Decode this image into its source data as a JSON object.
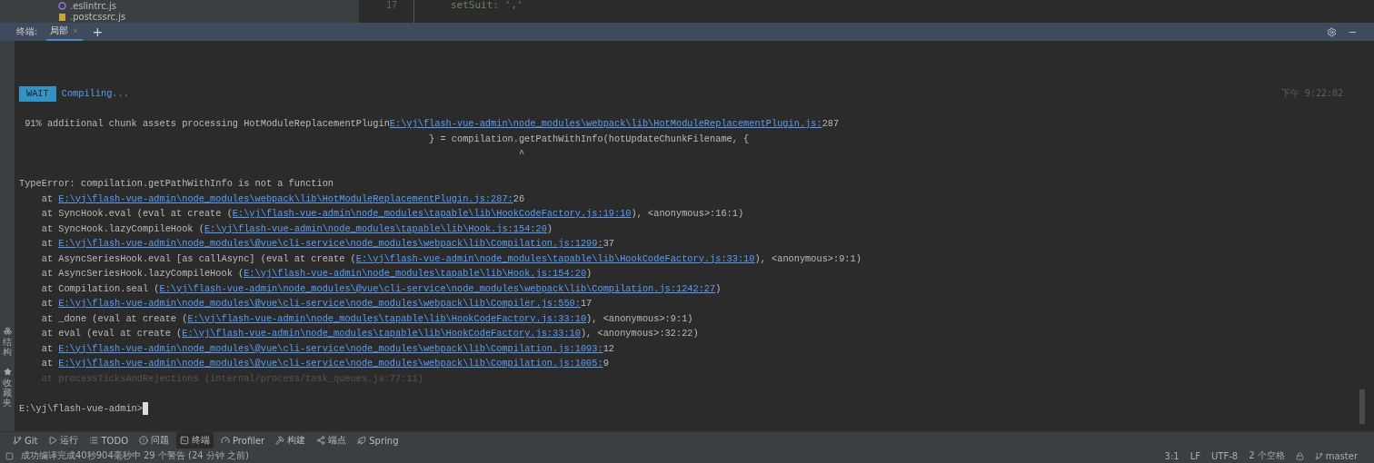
{
  "editor": {
    "files": [
      {
        "name": ".eslintrc.js",
        "kind": "eslint"
      },
      {
        "name": ".postcssrc.js",
        "kind": "js"
      }
    ],
    "line_number": "17",
    "code": "setSuit: ','"
  },
  "terminal": {
    "label": "终端:",
    "tabs": [
      {
        "label": "局部",
        "selected": true
      }
    ],
    "add": "+",
    "wait": {
      "badge": "WAIT",
      "text": "Compiling...",
      "time": "下午 9:22:02"
    },
    "lines": [
      {
        "blank_before": true,
        "segments": [
          {
            "kind": "text",
            "text": " 91% additional chunk assets processing HotModuleReplacementPlugin"
          },
          {
            "kind": "link",
            "text": "E:\\yj\\flash-vue-admin\\node_modules\\webpack\\lib\\HotModuleReplacementPlugin.js:"
          },
          {
            "kind": "text",
            "text": "287"
          }
        ]
      },
      {
        "segments": [
          {
            "kind": "text",
            "text": "                                                                         } = compilation.getPathWithInfo(hotUpdateChunkFilename, {"
          }
        ]
      },
      {
        "segments": [
          {
            "kind": "text",
            "text": "                                                                                         ^"
          }
        ]
      },
      {
        "blank_before": true,
        "segments": [
          {
            "kind": "text",
            "text": "TypeError: compilation.getPathWithInfo is not a function"
          }
        ]
      },
      {
        "segments": [
          {
            "kind": "text",
            "text": "    at "
          },
          {
            "kind": "link",
            "text": "E:\\yj\\flash-vue-admin\\node_modules\\webpack\\lib\\HotModuleReplacementPlugin.js:287:"
          },
          {
            "kind": "text",
            "text": "26"
          }
        ]
      },
      {
        "segments": [
          {
            "kind": "text",
            "text": "    at SyncHook.eval (eval at create ("
          },
          {
            "kind": "link",
            "text": "E:\\yj\\flash-vue-admin\\node_modules\\tapable\\lib\\HookCodeFactory.js:19:10"
          },
          {
            "kind": "text",
            "text": "), <anonymous>:16:1)"
          }
        ]
      },
      {
        "segments": [
          {
            "kind": "text",
            "text": "    at SyncHook.lazyCompileHook ("
          },
          {
            "kind": "link",
            "text": "E:\\yj\\flash-vue-admin\\node_modules\\tapable\\lib\\Hook.js:154:20"
          },
          {
            "kind": "text",
            "text": ")"
          }
        ]
      },
      {
        "segments": [
          {
            "kind": "text",
            "text": "    at "
          },
          {
            "kind": "link",
            "text": "E:\\yj\\flash-vue-admin\\node_modules\\@vue\\cli-service\\node_modules\\webpack\\lib\\Compilation.js:1299:"
          },
          {
            "kind": "text",
            "text": "37"
          }
        ]
      },
      {
        "segments": [
          {
            "kind": "text",
            "text": "    at AsyncSeriesHook.eval [as callAsync] (eval at create ("
          },
          {
            "kind": "link",
            "text": "E:\\yj\\flash-vue-admin\\node_modules\\tapable\\lib\\HookCodeFactory.js:33:10"
          },
          {
            "kind": "text",
            "text": "), <anonymous>:9:1)"
          }
        ]
      },
      {
        "segments": [
          {
            "kind": "text",
            "text": "    at AsyncSeriesHook.lazyCompileHook ("
          },
          {
            "kind": "link",
            "text": "E:\\yj\\flash-vue-admin\\node_modules\\tapable\\lib\\Hook.js:154:20"
          },
          {
            "kind": "text",
            "text": ")"
          }
        ]
      },
      {
        "segments": [
          {
            "kind": "text",
            "text": "    at Compilation.seal ("
          },
          {
            "kind": "link",
            "text": "E:\\yj\\flash-vue-admin\\node_modules\\@vue\\cli-service\\node_modules\\webpack\\lib\\Compilation.js:1242:27"
          },
          {
            "kind": "text",
            "text": ")"
          }
        ]
      },
      {
        "segments": [
          {
            "kind": "text",
            "text": "    at "
          },
          {
            "kind": "link",
            "text": "E:\\yj\\flash-vue-admin\\node_modules\\@vue\\cli-service\\node_modules\\webpack\\lib\\Compiler.js:550:"
          },
          {
            "kind": "text",
            "text": "17"
          }
        ]
      },
      {
        "segments": [
          {
            "kind": "text",
            "text": "    at _done (eval at create ("
          },
          {
            "kind": "link",
            "text": "E:\\yj\\flash-vue-admin\\node_modules\\tapable\\lib\\HookCodeFactory.js:33:10"
          },
          {
            "kind": "text",
            "text": "), <anonymous>:9:1)"
          }
        ]
      },
      {
        "segments": [
          {
            "kind": "text",
            "text": "    at eval (eval at create ("
          },
          {
            "kind": "link",
            "text": "E:\\yj\\flash-vue-admin\\node_modules\\tapable\\lib\\HookCodeFactory.js:33:10"
          },
          {
            "kind": "text",
            "text": "), <anonymous>:32:22)"
          }
        ]
      },
      {
        "segments": [
          {
            "kind": "text",
            "text": "    at "
          },
          {
            "kind": "link",
            "text": "E:\\yj\\flash-vue-admin\\node_modules\\@vue\\cli-service\\node_modules\\webpack\\lib\\Compilation.js:1093:"
          },
          {
            "kind": "text",
            "text": "12"
          }
        ]
      },
      {
        "segments": [
          {
            "kind": "text",
            "text": "    at "
          },
          {
            "kind": "link",
            "text": "E:\\yj\\flash-vue-admin\\node_modules\\@vue\\cli-service\\node_modules\\webpack\\lib\\Compilation.js:1005:"
          },
          {
            "kind": "text",
            "text": "9"
          }
        ]
      },
      {
        "segments": [
          {
            "kind": "dim",
            "text": "    at processTicksAndRejections (internal/process/task_queues.js:77:11)"
          }
        ]
      },
      {
        "blank_before": true,
        "segments": [
          {
            "kind": "text",
            "text": "E:\\yj\\flash-vue-admin>"
          }
        ],
        "cursor": true
      }
    ]
  },
  "side_tabs": [
    {
      "label": "结构",
      "kind": "structure"
    },
    {
      "label": "收藏夹",
      "kind": "star"
    }
  ],
  "tool_tabs": [
    {
      "label": "Git",
      "kind": "git",
      "selected": false
    },
    {
      "label": "运行",
      "kind": "run",
      "selected": false
    },
    {
      "label": "TODO",
      "kind": "todo",
      "selected": false
    },
    {
      "label": "问题",
      "kind": "problems",
      "selected": false
    },
    {
      "label": "终端",
      "kind": "terminal",
      "selected": true
    },
    {
      "label": "Profiler",
      "kind": "profiler",
      "selected": false
    },
    {
      "label": "构建",
      "kind": "build",
      "selected": false
    },
    {
      "label": "端点",
      "kind": "endpoints",
      "selected": false
    },
    {
      "label": "Spring",
      "kind": "spring",
      "selected": false
    }
  ],
  "status_bar": {
    "message": "成功编译完成40秒904毫秒中 29 个警告 (24 分钟 之前)",
    "items": [
      "3:1",
      "LF",
      "UTF-8",
      "2 个空格"
    ],
    "branch": "master"
  }
}
